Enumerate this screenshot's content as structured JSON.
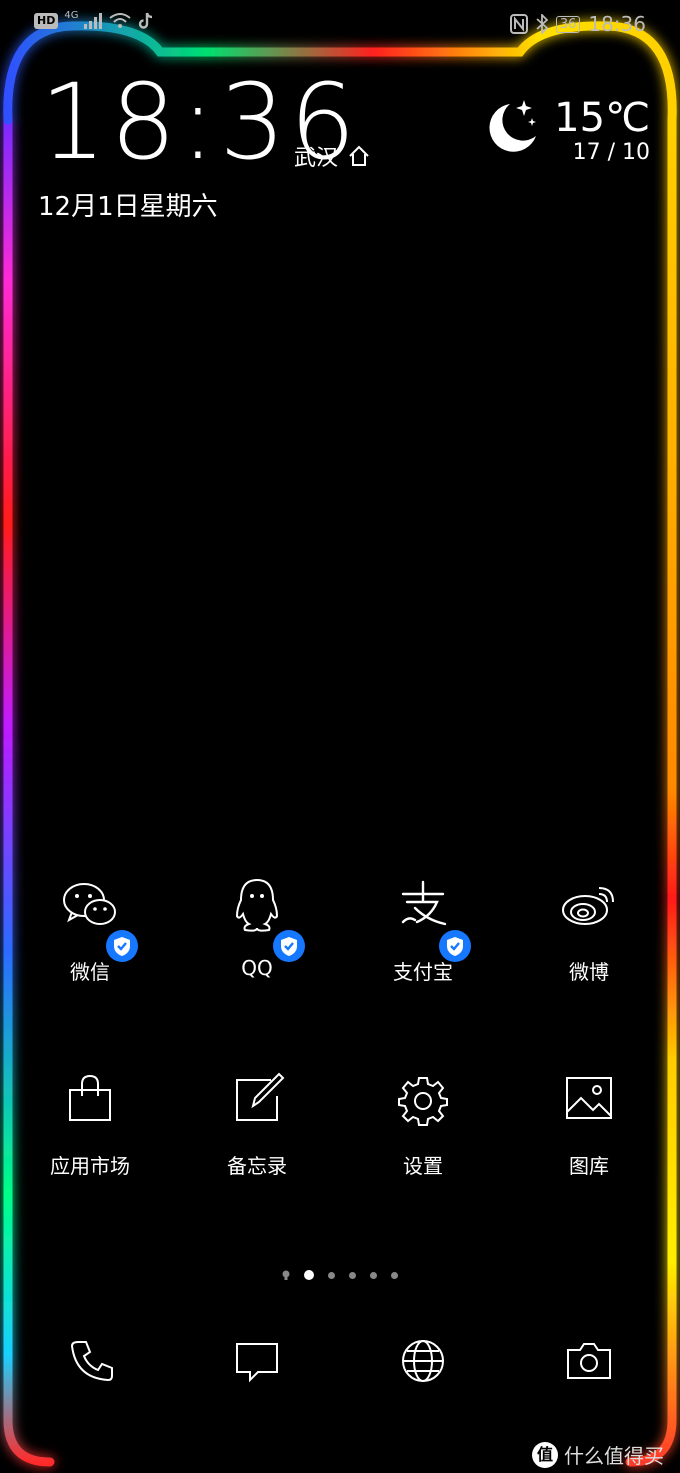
{
  "status_bar": {
    "network_badge": "HD",
    "network_type": "4G",
    "icons": [
      "signal-icon",
      "wifi-icon",
      "tiktok-icon",
      "nfc-icon",
      "bluetooth-icon",
      "battery-icon"
    ],
    "battery": "36",
    "time": "18:36"
  },
  "lockscreen_widget": {
    "clock": "18:36",
    "city": "武汉",
    "date": "12月1日星期六",
    "weather_icon": "moon-stars-icon",
    "temperature": "15℃",
    "range": "17 / 10"
  },
  "apps_row1": [
    {
      "label": "微信",
      "icon": "wechat-icon",
      "verified": true
    },
    {
      "label": "QQ",
      "icon": "qq-icon",
      "verified": true
    },
    {
      "label": "支付宝",
      "icon": "alipay-icon",
      "verified": true
    },
    {
      "label": "微博",
      "icon": "weibo-icon",
      "verified": false
    }
  ],
  "apps_row2": [
    {
      "label": "应用市场",
      "icon": "appstore-bag-icon"
    },
    {
      "label": "备忘录",
      "icon": "notepad-icon"
    },
    {
      "label": "设置",
      "icon": "gear-icon"
    },
    {
      "label": "图库",
      "icon": "gallery-icon"
    }
  ],
  "page_indicator": {
    "pages": 5,
    "active": 1
  },
  "dock": [
    "phone-icon",
    "message-icon",
    "browser-icon",
    "camera-icon"
  ],
  "watermark": {
    "logo": "值",
    "text": "什么值得买"
  },
  "colors": {
    "background": "#000000",
    "badge": "#1677ff"
  }
}
